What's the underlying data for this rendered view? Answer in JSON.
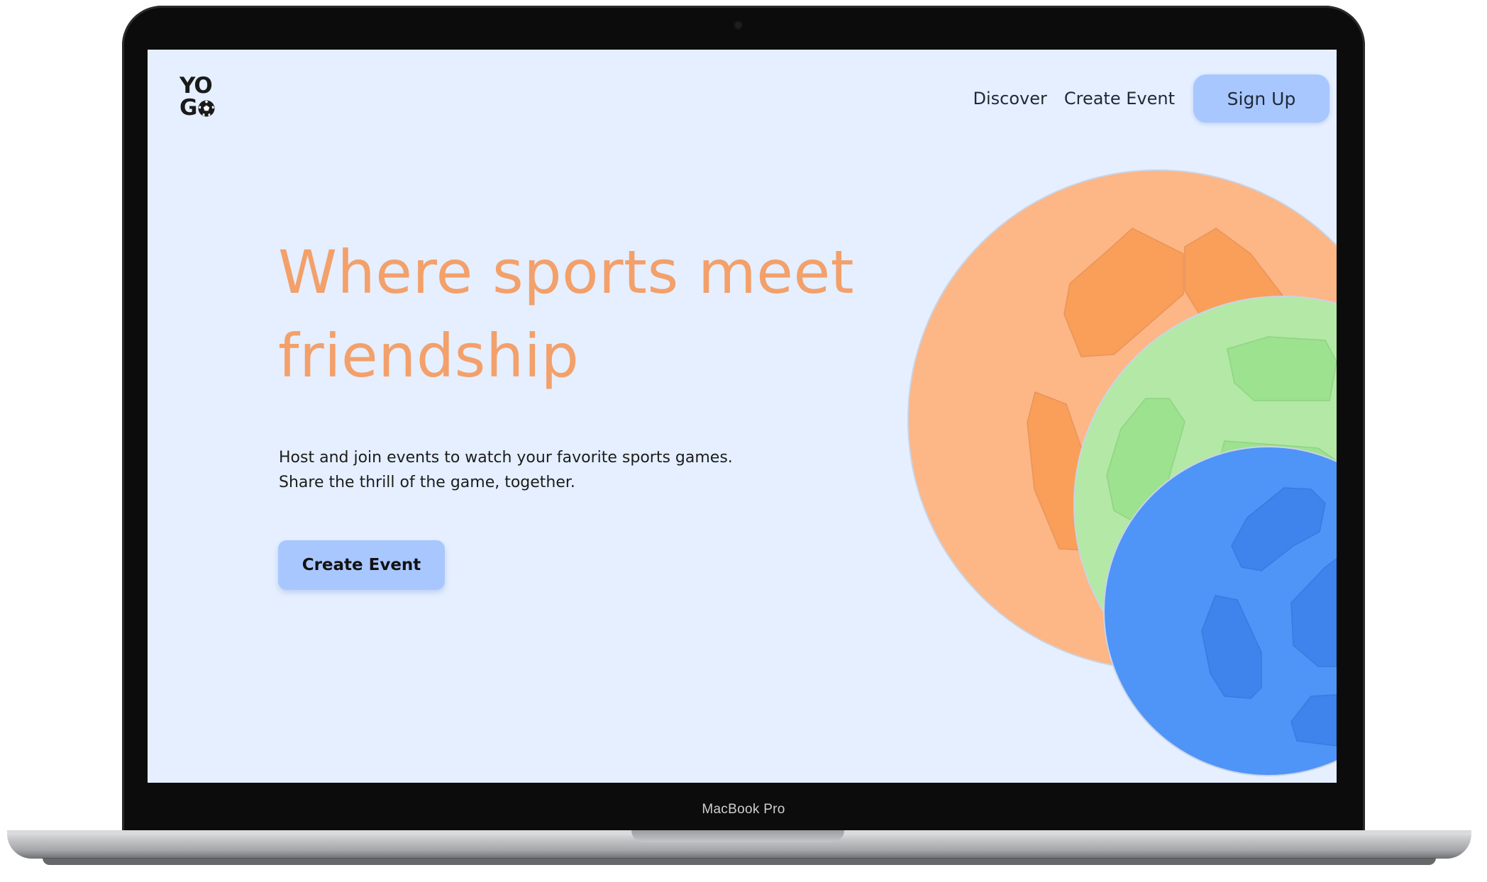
{
  "device": {
    "model_label": "MacBook Pro"
  },
  "brand": {
    "logo_top": "YO",
    "logo_bottom": "G"
  },
  "nav": {
    "items": [
      {
        "label": "Discover"
      },
      {
        "label": "Create Event"
      }
    ],
    "cta_label": "Sign Up"
  },
  "hero": {
    "title_line1": "Where sports meet",
    "title_line2": "friendship",
    "subtitle_line1": "Host and join events to watch your favorite sports games.",
    "subtitle_line2": "Share the thrill of the game, together.",
    "cta_label": "Create Event"
  },
  "colors": {
    "screen_bg": "#e5efff",
    "accent_orange": "#f3a06a",
    "button_blue": "#a9c7ff",
    "ball_orange": "#fdb685",
    "ball_green": "#b3e8a6",
    "ball_blue": "#4f94f7"
  },
  "icons": {
    "logo_ball": "soccer-ball-icon",
    "hero_illustration": "soccer-balls-illustration"
  }
}
